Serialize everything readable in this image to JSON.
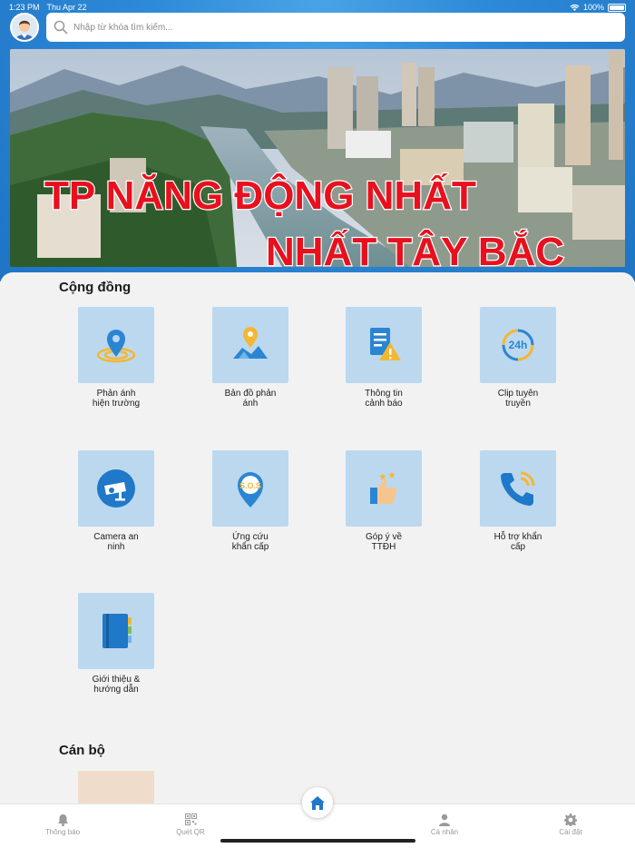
{
  "status": {
    "time": "1:23 PM",
    "date": "Thu Apr 22",
    "battery": "100%"
  },
  "search": {
    "placeholder": "Nhập từ khóa tìm kiếm..."
  },
  "banner": {
    "line1": "TP NĂNG ĐỘNG NHẤT",
    "line2": "NHẤT TÂY BẮC"
  },
  "community": {
    "title": "Cộng đồng",
    "tiles": [
      {
        "label": "Phản ánh\nhiện trường",
        "icon": "location-pin-icon"
      },
      {
        "label": "Bản đồ phản\nánh",
        "icon": "map-pin-icon"
      },
      {
        "label": "Thông tin\ncảnh báo",
        "icon": "warning-document-icon"
      },
      {
        "label": "Clip tuyên\ntruyền",
        "icon": "24h-clock-icon"
      },
      {
        "label": "Camera an\nninh",
        "icon": "security-camera-icon"
      },
      {
        "label": "Ứng cứu\nkhẩn cấp",
        "icon": "sos-pin-icon"
      },
      {
        "label": "Góp ý về\nTTĐH",
        "icon": "thumbs-up-icon"
      },
      {
        "label": "Hỗ trợ khẩn\ncấp",
        "icon": "phone-call-icon"
      },
      {
        "label": "Giới thiệu &\nhướng dẫn",
        "icon": "book-icon"
      }
    ]
  },
  "officials": {
    "title": "Cán bộ"
  },
  "tabbar": {
    "notifications": "Thông báo",
    "scan_qr": "Quét QR",
    "home": "",
    "profile": "Cá nhân",
    "settings": "Cài đặt"
  },
  "colors": {
    "primary": "#2d8ad8",
    "tile_bg": "#bcd8ee",
    "banner_text": "#e8101e",
    "icon_blue": "#1f78c8",
    "icon_yellow": "#f4b731"
  }
}
